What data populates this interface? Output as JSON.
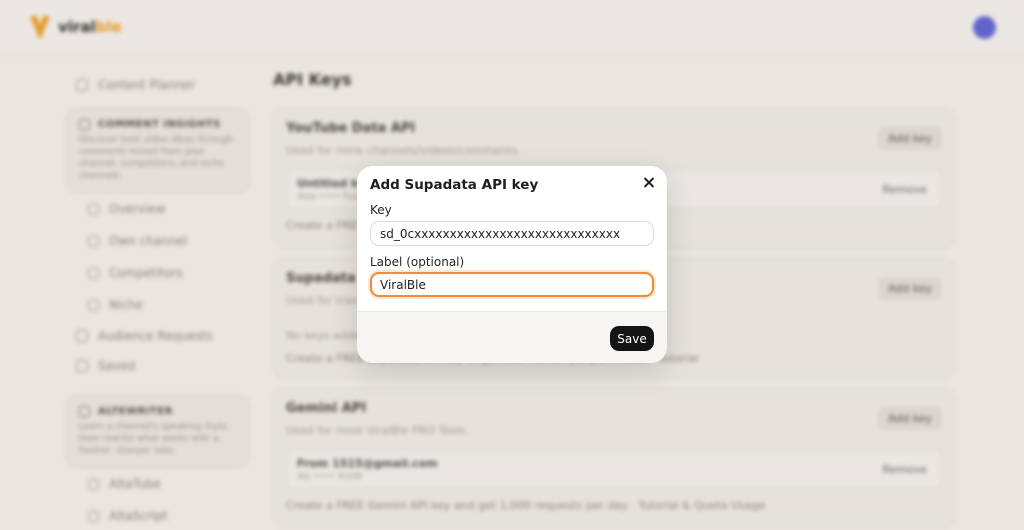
{
  "app": {
    "logo_text": "viral",
    "logo_accent": "ble"
  },
  "sidebar": {
    "top_item": "Content Planner",
    "comment_insights": {
      "title": "COMMENT INSIGHTS",
      "desc": "Discover best video ideas through comments mined from your channel, competitors, and niche channels.",
      "items": [
        "Overview",
        "Own channel",
        "Competitors",
        "Niche"
      ]
    },
    "more_items": [
      "Audience Requests",
      "Saved"
    ],
    "altwriter": {
      "title": "ALTEWRITER",
      "desc": "Learn a channel's speaking style, then rewrite what works with a fresher, sharper take.",
      "items": [
        "AltaTube",
        "AltaScript"
      ]
    }
  },
  "main": {
    "title": "API Keys",
    "youtube": {
      "title": "YouTube Data API",
      "desc": "Used for mine channels/videos/comments.",
      "add_label": "Add key",
      "key_name": "Untitled key",
      "key_mask": "AIza •••• Fuq",
      "remove_label": "Remove",
      "links": "Create a FREE YouTube API key · Tutorial & Quota Usage"
    },
    "supadata": {
      "title": "Supadata API",
      "desc": "Used for transcripts.",
      "add_label": "Add key",
      "no_keys": "No keys added yet.",
      "links": "Create a FREE Supadata API key to get 100 transcripts per month · Tutorial"
    },
    "gemini": {
      "title": "Gemini API",
      "desc": "Used for most ViralBle PRO Tools.",
      "add_label": "Add key",
      "key_name": "From 1515@gmail.com",
      "key_mask": "AIz •••• X1H9",
      "remove_label": "Remove",
      "links": "Create a FREE Gemini API key and get 1,000 requests per day · Tutorial & Quota Usage"
    }
  },
  "modal": {
    "title": "Add Supadata API key",
    "key_label": "Key",
    "key_value": "sd_0cxxxxxxxxxxxxxxxxxxxxxxxxxxxxx",
    "label_label": "Label (optional)",
    "label_value": "ViralBle",
    "save_label": "Save"
  },
  "colors": {
    "accent": "#f08c3a",
    "brand": "#f0a22a",
    "primary_button": "#141414",
    "avatar": "#6468d8"
  },
  "icons": {
    "close": "close-icon",
    "logo": "logo-icon"
  }
}
